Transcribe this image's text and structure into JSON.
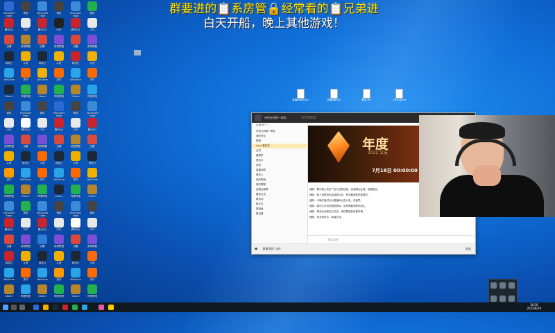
{
  "overlay": {
    "line1": "群要进的📋系房管🔒经常看的📋兄弟进",
    "line2": "白天开船，晚上其他游戏！"
  },
  "desktop_icons": [
    {
      "label": "Microsoft Edge",
      "color": "#2d6ad6"
    },
    {
      "label": "腾讯QQ",
      "color": "#ffffff"
    },
    {
      "label": "迅雷",
      "color": "#2f7bd8"
    },
    {
      "label": "网易云",
      "color": "#c8242e"
    },
    {
      "label": "WeGame",
      "color": "#f0b000"
    },
    {
      "label": "Steam",
      "color": "#1b2838"
    },
    {
      "label": "微信",
      "color": "#22b14c"
    },
    {
      "label": "OBS",
      "color": "#222"
    },
    {
      "label": "英雄联盟",
      "color": "#b8862a"
    },
    {
      "label": "斗鱼",
      "color": "#ff6a00"
    },
    {
      "label": "虎牙",
      "color": "#ff9a00"
    },
    {
      "label": "哔哩哔哩",
      "color": "#2aa4e6"
    }
  ],
  "desktop_files": [
    {
      "label": "直播间规则.txt"
    },
    {
      "label": "开播流程.txt"
    },
    {
      "label": "备忘.txt"
    },
    {
      "label": "工作记录.txt"
    }
  ],
  "chat_window": {
    "title": "永恒无间群一群友",
    "id": "87770552",
    "sidebar": [
      "永恒无间群一群友",
      "我的好友",
      "群聊",
      "Love 群成员",
      "全员",
      "管理员",
      "禁言中",
      "其他",
      "直播间群",
      "联系人",
      "我的群组",
      "新的群聊",
      "查看全部群",
      "置顶公告",
      "群活动",
      "群文件",
      "群相册",
      "群设置"
    ],
    "poster": {
      "big": "年度",
      "sub": "2022 文友",
      "date": "7月18日 00:00:00"
    },
    "messages": [
      "通知：群内禁止发布广告与违规信息，违者踢出处理，感谢配合。",
      "通知：新人进群请先阅读群公告，有问题请联系管理员。",
      "通知：今晚开船时间以直播间公告为准，请留意。",
      "通知：群内文件请勿随意删除，如有需要请联系群主。",
      "通知：周末活动报名已开启，请在群相册查看详情。",
      "通知：请文明发言，和谐交流。"
    ],
    "composer_placeholder": "发送消息",
    "footer_left": "表情  图片  文件",
    "footer_right": "发送"
  },
  "taskbar": {
    "time": "16:56",
    "date": "2022/8/19"
  }
}
